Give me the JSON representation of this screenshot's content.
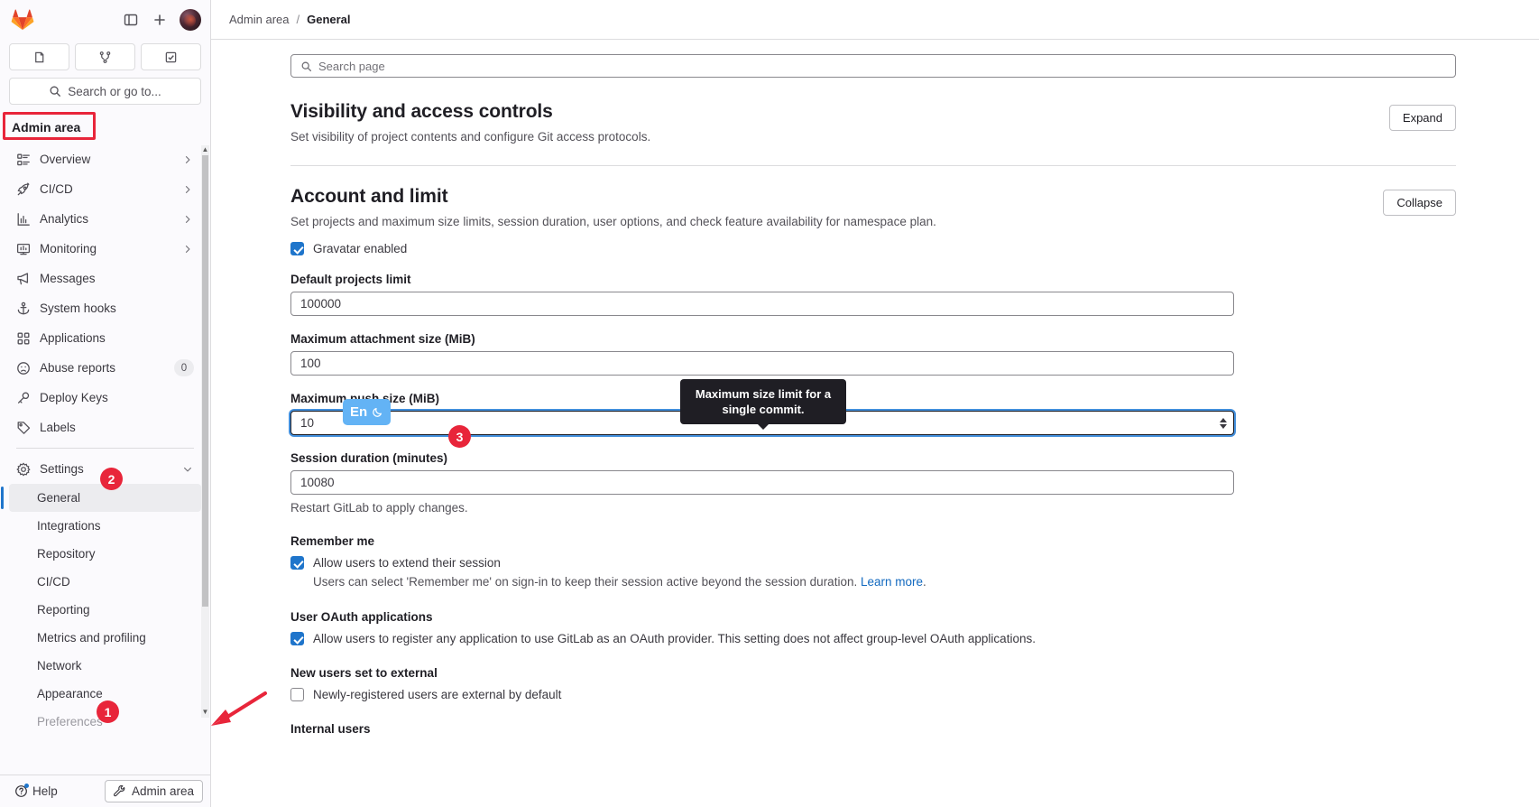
{
  "app": {
    "name": "GitLab",
    "accent": "#1f75cb",
    "marker_color": "#e8253a"
  },
  "sidebar": {
    "logo_name": "gitlab-logo",
    "top_icons": [
      {
        "name": "sidebar-toggle-icon",
        "title": "Primary navigation sidebar"
      },
      {
        "name": "create-new-icon",
        "title": "Create new..."
      }
    ],
    "avatar_label": "user-avatar",
    "tiles": [
      {
        "name": "issues-tile",
        "icon": "issues-icon"
      },
      {
        "name": "merge-requests-tile",
        "icon": "merge-request-icon"
      },
      {
        "name": "todos-tile",
        "icon": "todo-done-icon"
      }
    ],
    "search": {
      "label": "Search or go to...",
      "icon": "search-icon"
    },
    "context": {
      "label": "Admin area",
      "highlighted": true
    },
    "items": [
      {
        "label": "Overview",
        "icon": "overview-icon",
        "chevron": "right"
      },
      {
        "label": "CI/CD",
        "icon": "rocket-icon",
        "chevron": "right"
      },
      {
        "label": "Analytics",
        "icon": "chart-icon",
        "chevron": "right"
      },
      {
        "label": "Monitoring",
        "icon": "monitor-icon",
        "chevron": "right"
      },
      {
        "label": "Messages",
        "icon": "megaphone-icon",
        "chevron": ""
      },
      {
        "label": "System hooks",
        "icon": "anchor-icon",
        "chevron": ""
      },
      {
        "label": "Applications",
        "icon": "applications-icon",
        "chevron": ""
      },
      {
        "label": "Abuse reports",
        "icon": "abuse-report-icon",
        "chevron": "",
        "badge": "0"
      },
      {
        "label": "Deploy Keys",
        "icon": "key-icon",
        "chevron": ""
      },
      {
        "label": "Labels",
        "icon": "label-icon",
        "chevron": ""
      }
    ],
    "settings": {
      "label": "Settings",
      "icon": "gear-icon",
      "chevron": "down",
      "expanded": true
    },
    "sub_items": [
      {
        "label": "General",
        "active": true
      },
      {
        "label": "Integrations",
        "active": false
      },
      {
        "label": "Repository",
        "active": false
      },
      {
        "label": "CI/CD",
        "active": false
      },
      {
        "label": "Reporting",
        "active": false
      },
      {
        "label": "Metrics and profiling",
        "active": false
      },
      {
        "label": "Network",
        "active": false
      },
      {
        "label": "Appearance",
        "active": false
      },
      {
        "label": "Preferences",
        "active": false,
        "faded": true
      }
    ],
    "footer": {
      "help_label": "Help",
      "help_icon": "help-icon",
      "admin_label": "Admin area",
      "admin_icon": "wrench-icon"
    }
  },
  "breadcrumb": {
    "root": "Admin area",
    "separator": "/",
    "current": "General"
  },
  "page_search": {
    "placeholder": "Search page",
    "icon": "search-icon",
    "value": ""
  },
  "sections": [
    {
      "title": "Visibility and access controls",
      "description": "Set visibility of project contents and configure Git access protocols.",
      "toggle_label": "Expand"
    },
    {
      "title": "Account and limit",
      "description": "Set projects and maximum size limits, session duration, user options, and check feature availability for namespace plan.",
      "toggle_label": "Collapse"
    }
  ],
  "form": {
    "gravatar": {
      "label": "Gravatar enabled",
      "checked": true
    },
    "default_projects_limit": {
      "label": "Default projects limit",
      "value": "100000"
    },
    "max_attachment_size": {
      "label": "Maximum attachment size (MiB)",
      "value": "100"
    },
    "max_push_size": {
      "label": "Maximum push size (MiB)",
      "value": "10",
      "focused": true
    },
    "session_duration": {
      "label": "Session duration (minutes)",
      "value": "10080",
      "hint": "Restart GitLab to apply changes."
    },
    "remember_me": {
      "group_title": "Remember me",
      "checkbox_label": "Allow users to extend their session",
      "checked": true,
      "help_text": "Users can select 'Remember me' on sign-in to keep their session active beyond the session duration.",
      "help_link": "Learn more",
      "help_suffix": "."
    },
    "user_oauth": {
      "group_title": "User OAuth applications",
      "checkbox_label": "Allow users to register any application to use GitLab as an OAuth provider. This setting does not affect group-level OAuth applications.",
      "checked": true
    },
    "new_users_external": {
      "group_title": "New users set to external",
      "checkbox_label": "Newly-registered users are external by default",
      "checked": false
    },
    "internal_users": {
      "group_title": "Internal users"
    }
  },
  "tooltip": {
    "text": "Maximum size limit for a single commit."
  },
  "ime_badge": {
    "text": "En",
    "icon": "crescent-moon-icon"
  },
  "markers": [
    {
      "number": "1"
    },
    {
      "number": "2"
    },
    {
      "number": "3"
    }
  ]
}
